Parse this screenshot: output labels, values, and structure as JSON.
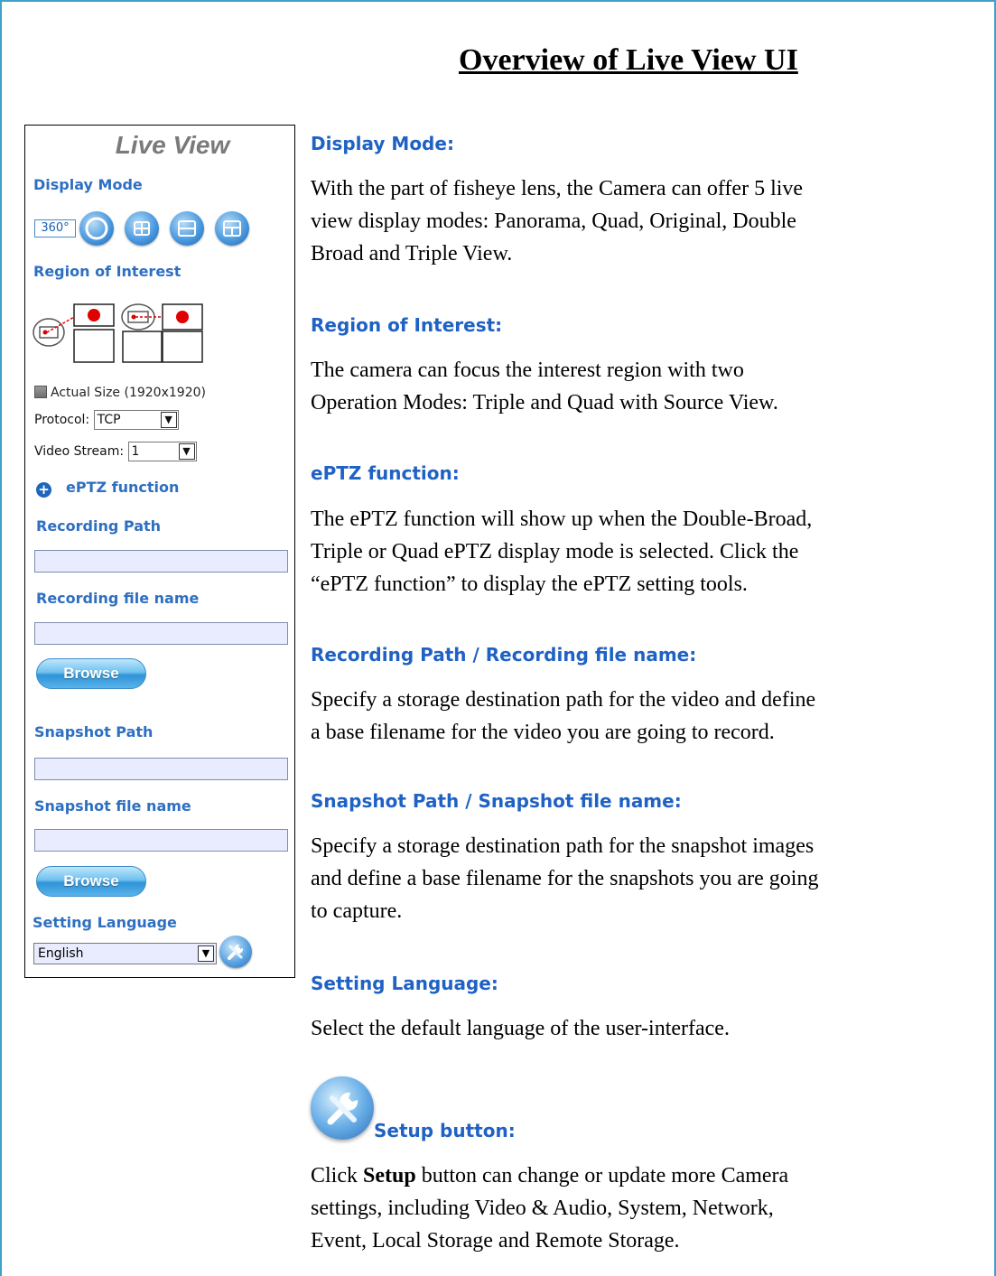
{
  "page": {
    "title": "Overview of Live View UI"
  },
  "panel": {
    "title": "Live View",
    "display_mode_label": "Display Mode",
    "mode_360_label": "360°",
    "roi_label": "Region of Interest",
    "actual_size_label": "Actual Size (1920x1920)",
    "protocol_label": "Protocol:",
    "protocol_value": "TCP",
    "video_stream_label": "Video Stream:",
    "video_stream_value": "1",
    "eptz_label": "ePTZ function",
    "recording_path_label": "Recording Path",
    "recording_file_label": "Recording file name",
    "browse_label": "Browse",
    "snapshot_path_label": "Snapshot Path",
    "snapshot_file_label": "Snapshot file name",
    "setting_language_label": "Setting Language",
    "language_value": "English"
  },
  "sections": [
    {
      "heading": "Display Mode:",
      "lines": [
        "With the part of fisheye lens, the Camera can offer 5 live",
        "view display modes: Panorama, Quad, Original, Double",
        "Broad and Triple View."
      ]
    },
    {
      "heading": "Region of Interest:",
      "lines": [
        "The camera can focus the interest region with two",
        "Operation Modes: Triple and Quad with Source View."
      ]
    },
    {
      "heading": "ePTZ function:",
      "lines": [
        "The ePTZ function will show up when the Double-Broad,",
        "Triple or Quad ePTZ display mode is selected. Click the",
        "“ePTZ function” to display the ePTZ setting tools."
      ]
    },
    {
      "heading": "Recording Path / Recording file name:",
      "lines": [
        "Specify a storage destination path for the video and define",
        "a base filename for the video you are going to record."
      ]
    },
    {
      "heading": "Snapshot Path / Snapshot file name:",
      "lines": [
        "Specify a storage destination path for the snapshot images",
        "and define a base filename for the snapshots you are going",
        "to capture."
      ]
    },
    {
      "heading": "Setting Language:",
      "lines": [
        "Select the default language of the user-interface."
      ]
    }
  ],
  "setup": {
    "heading": "Setup button:",
    "line1_prefix": "Click ",
    "line1_bold": "Setup",
    "line1_suffix": " button can change or update more Camera",
    "line2": "settings, including Video & Audio, System, Network,",
    "line3": "Event, Local Storage and Remote Storage."
  },
  "colors": {
    "frame": "#3fa0c8",
    "heading_blue": "#1f62c4",
    "panel_label_blue": "#2e6fc2",
    "button_blue": "#2f93d6"
  },
  "icons": [
    "panorama-360-icon",
    "original-mode-icon",
    "quad-mode-icon",
    "double-mode-icon",
    "triple-mode-icon",
    "roi-triple-icon",
    "roi-quad-icon",
    "plus-circle-icon",
    "setup-tools-icon"
  ]
}
